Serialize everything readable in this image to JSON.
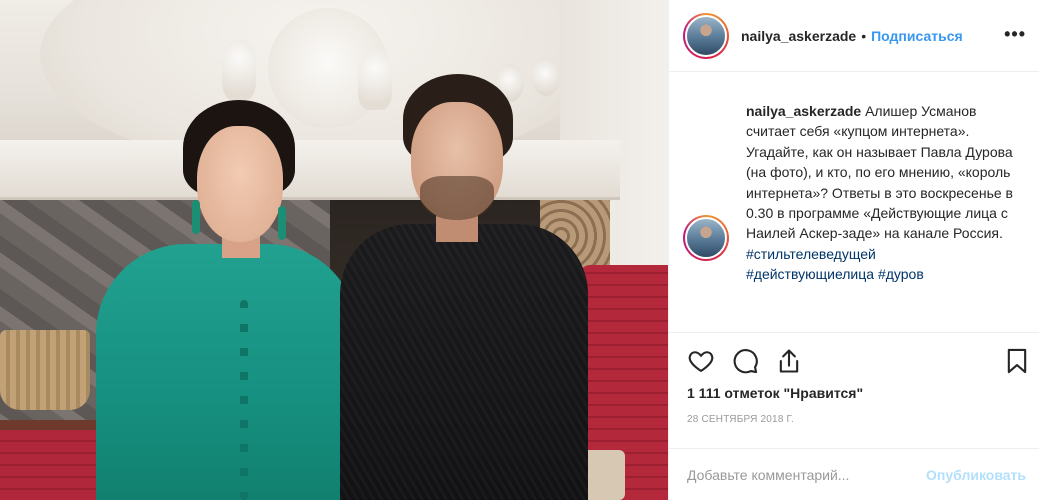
{
  "post": {
    "username": "nailya_askerzade",
    "separator": "•",
    "follow_label": "Подписаться",
    "more_label": "•••"
  },
  "caption": {
    "username": "nailya_askerzade",
    "text": "Алишер Усманов считает себя «купцом интернета». Угадайте, как он называет Павла Дурова (на фото), и кто, по его мнению, «король интернета»? Ответы в это воскресенье в 0.30 в программе «Действующие лица с Наилей Аскер-заде» на канале Россия.",
    "hashtags": [
      "#стильтелеведущей",
      "#действующиелица #дуров"
    ]
  },
  "actions": {
    "like_icon": "heart-icon",
    "comment_icon": "comment-icon",
    "share_icon": "share-icon",
    "save_icon": "bookmark-icon",
    "likes_text": "1 111 отметок \"Нравится\"",
    "date": "28 СЕНТЯБРЯ 2018 Г."
  },
  "comment_box": {
    "placeholder": "Добавьте комментарий...",
    "publish_label": "Опубликовать"
  },
  "colors": {
    "accent": "#3897f0",
    "hashtag": "#003569",
    "muted": "#999999",
    "publish_disabled": "#b2dffc"
  }
}
